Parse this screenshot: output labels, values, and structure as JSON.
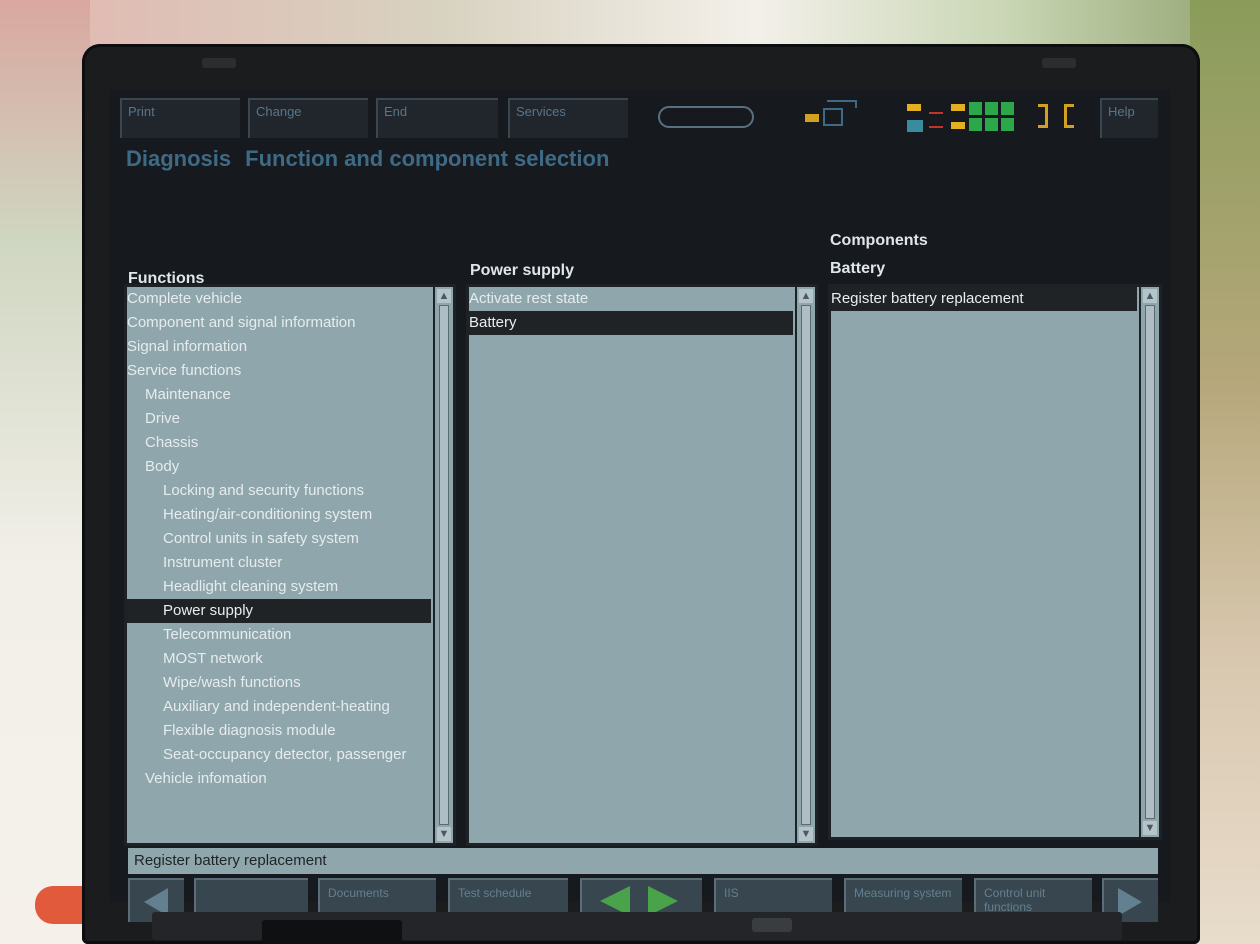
{
  "toolbar": {
    "print": "Print",
    "change": "Change",
    "end": "End",
    "services": "Services",
    "help": "Help"
  },
  "title": {
    "main": "Diagnosis",
    "sub": "Function and component selection"
  },
  "functions": {
    "header": "Functions",
    "items": [
      {
        "label": "Complete vehicle",
        "indent": 0
      },
      {
        "label": "Component and signal information",
        "indent": 0
      },
      {
        "label": "Signal information",
        "indent": 0
      },
      {
        "label": "Service functions",
        "indent": 0
      },
      {
        "label": "Maintenance",
        "indent": 1
      },
      {
        "label": "Drive",
        "indent": 1
      },
      {
        "label": "Chassis",
        "indent": 1
      },
      {
        "label": "Body",
        "indent": 1
      },
      {
        "label": "Locking and security functions",
        "indent": 2
      },
      {
        "label": "Heating/air-conditioning system",
        "indent": 2
      },
      {
        "label": "Control units in safety system",
        "indent": 2
      },
      {
        "label": "Instrument cluster",
        "indent": 2
      },
      {
        "label": "Headlight cleaning system",
        "indent": 2
      },
      {
        "label": "Power supply",
        "indent": 2,
        "selected": true
      },
      {
        "label": "Telecommunication",
        "indent": 2
      },
      {
        "label": "MOST network",
        "indent": 2
      },
      {
        "label": "Wipe/wash functions",
        "indent": 2
      },
      {
        "label": "Auxiliary and independent-heating",
        "indent": 2
      },
      {
        "label": "Flexible diagnosis module",
        "indent": 2
      },
      {
        "label": "Seat-occupancy detector, passenger",
        "indent": 2
      },
      {
        "label": "Vehicle infomation",
        "indent": 1
      }
    ]
  },
  "power_supply": {
    "header": "Power supply",
    "items": [
      {
        "label": "Activate rest state"
      },
      {
        "label": "Battery",
        "selected": true
      }
    ]
  },
  "components": {
    "header": "Components",
    "subheader": "Battery",
    "items": [
      {
        "label": "Register battery replacement",
        "selected": true
      }
    ]
  },
  "statusbar": {
    "text": "Register battery replacement"
  },
  "bottom_buttons": {
    "documents": "Documents",
    "test_schedule": "Test schedule",
    "iis": "IIS",
    "measuring": "Measuring system",
    "control_unit": "Control unit functions"
  },
  "colors": {
    "panel": "#8fa6ad",
    "title": "#3f6a86",
    "selected": "#1f2326",
    "status_green": "#2aa84a",
    "status_yellow": "#e2b020"
  }
}
